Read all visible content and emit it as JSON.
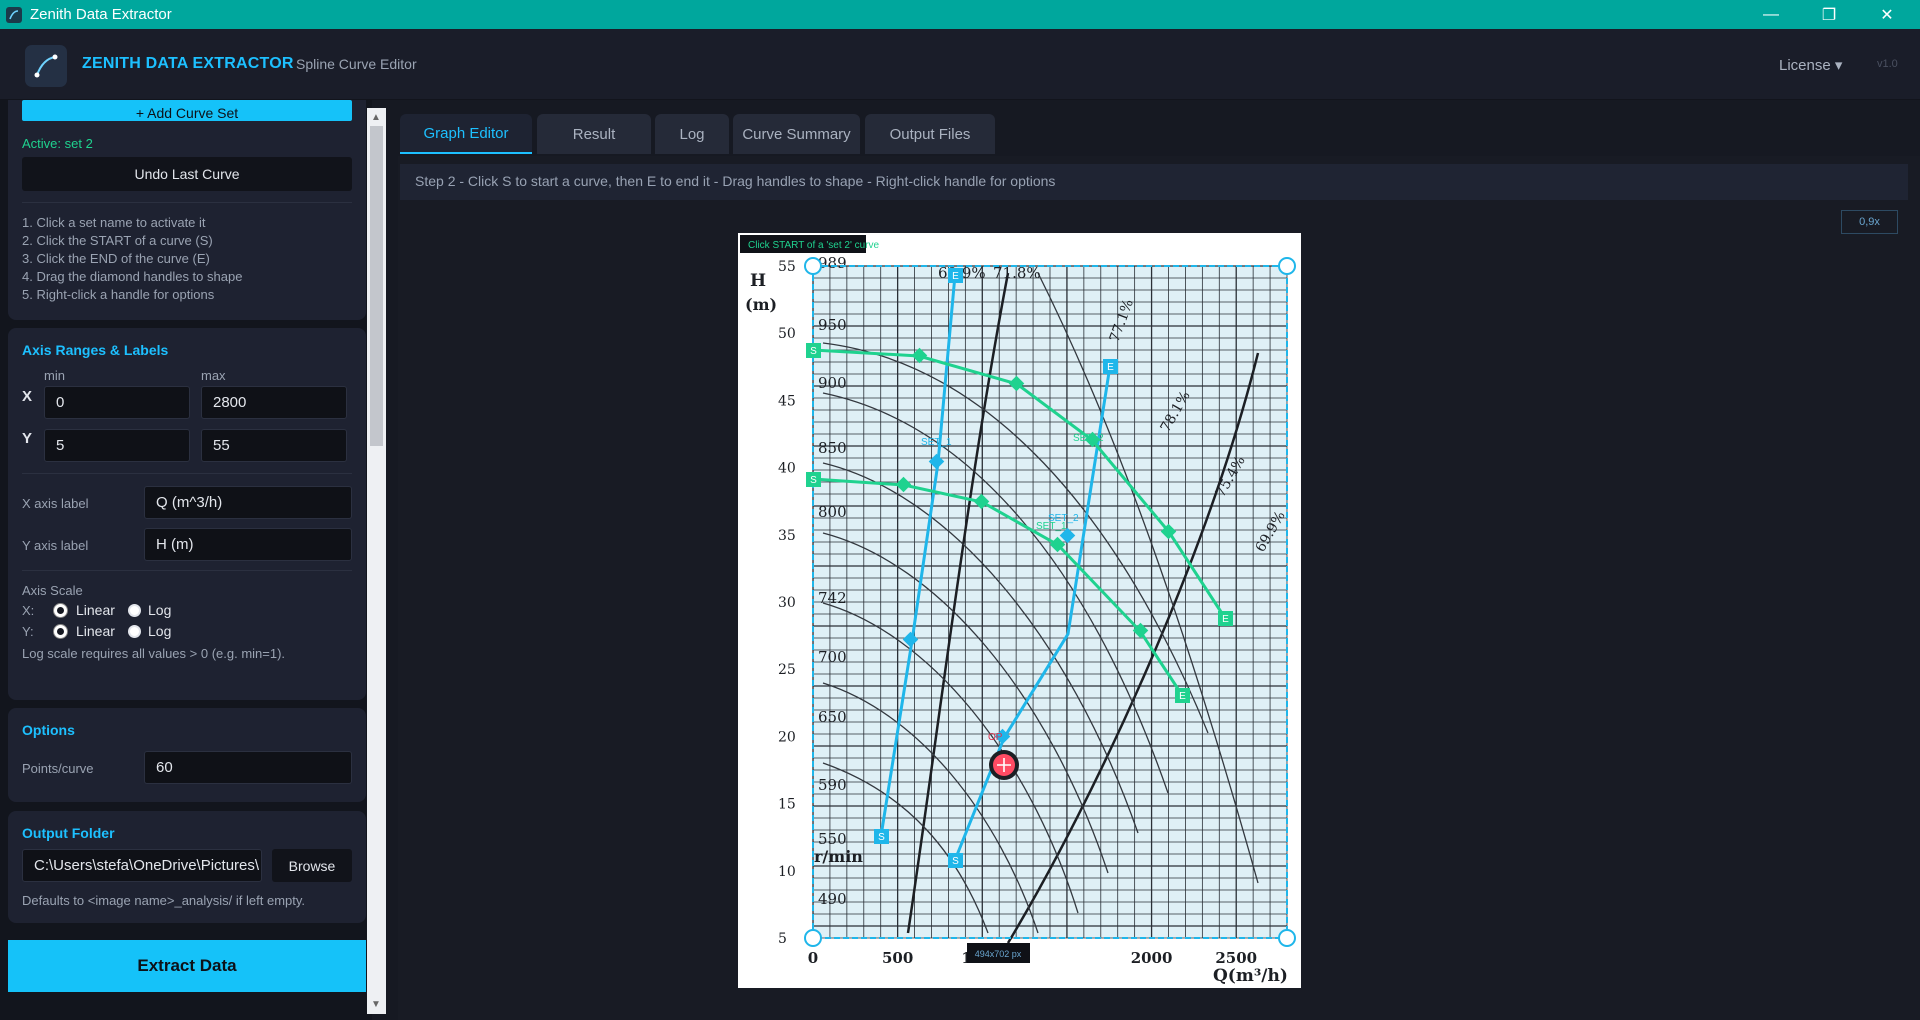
{
  "window": {
    "title": "Zenith Data Extractor",
    "minimize": "—",
    "restore": "❐",
    "close": "✕"
  },
  "header": {
    "brand": "ZENITH DATA EXTRACTOR",
    "subtitle": "Spline Curve Editor",
    "license": "License ▾",
    "version": "v1.0"
  },
  "sidebar": {
    "add_curve_set": "+ Add Curve Set",
    "active_set": "Active: set 2",
    "undo_label": "Undo Last Curve",
    "instructions": [
      "1. Click a set name to activate it",
      "2. Click the START of a curve (S)",
      "3. Click the END of the curve (E)",
      "4. Drag the diamond handles to shape",
      "5. Right-click a handle for options"
    ],
    "axis_panel": {
      "title": "Axis Ranges & Labels",
      "min_label": "min",
      "max_label": "max",
      "x_label": "X",
      "y_label": "Y",
      "x_min": "0",
      "x_max": "2800",
      "y_min": "5",
      "y_max": "55",
      "x_axis_label_caption": "X axis label",
      "x_axis_label_value": "Q (m^3/h)",
      "y_axis_label_caption": "Y axis label",
      "y_axis_label_value": "H (m)",
      "scale_title": "Axis Scale",
      "x_scale_caption": "X:",
      "y_scale_caption": "Y:",
      "linear": "Linear",
      "log": "Log",
      "x_scale": "Linear",
      "y_scale": "Linear",
      "log_note": "Log scale requires all values > 0 (e.g. min=1)."
    },
    "options_panel": {
      "title": "Options",
      "points_caption": "Points/curve",
      "points_value": "60"
    },
    "output_panel": {
      "title": "Output Folder",
      "path": "C:\\Users\\stefa\\OneDrive\\Pictures\\",
      "browse": "Browse",
      "note": "Defaults to <image name>_analysis/ if left empty."
    },
    "extract": "Extract Data"
  },
  "tabs": [
    "Graph Editor",
    "Result",
    "Log",
    "Curve Summary",
    "Output Files"
  ],
  "active_tab": "Graph Editor",
  "step_text": "Step 2 - Click S to start a curve, then E to end it  -  Drag handles to shape  -  Right-click handle for options",
  "zoom": "0,9x",
  "canvas": {
    "hint": "Click START of a 'set 2' curve",
    "size_badge": "494x702 px",
    "op_label": "OP",
    "set_labels": [
      "SET_1",
      "SET_2",
      "SET_2",
      "SET_1"
    ],
    "handle_s": "S",
    "handle_e": "E",
    "chart_y_title": "H",
    "chart_y_unit": "(m)",
    "chart_x_title": "Q(m³/h)",
    "y_ticks": [
      "55",
      "50",
      "45",
      "40",
      "35",
      "30",
      "25",
      "20",
      "15",
      "10",
      "5"
    ],
    "x_ticks": [
      "0",
      "500",
      "1000",
      "2000",
      "2500"
    ],
    "rpm_labels": [
      "989",
      "950",
      "900",
      "850",
      "800",
      "742",
      "700",
      "650",
      "590",
      "550",
      "490"
    ],
    "rpm_unit": "r/min",
    "efficiency_labels": [
      "69.9%",
      "71.8%",
      "77.1%",
      "78.1%",
      "75.4%",
      "69.9%"
    ]
  },
  "colors": {
    "accent": "#1dc0ff",
    "titlebar": "#00a79d",
    "green": "#1fd28f",
    "blue": "#1fb6ea",
    "active_text": "#1fd28f"
  }
}
